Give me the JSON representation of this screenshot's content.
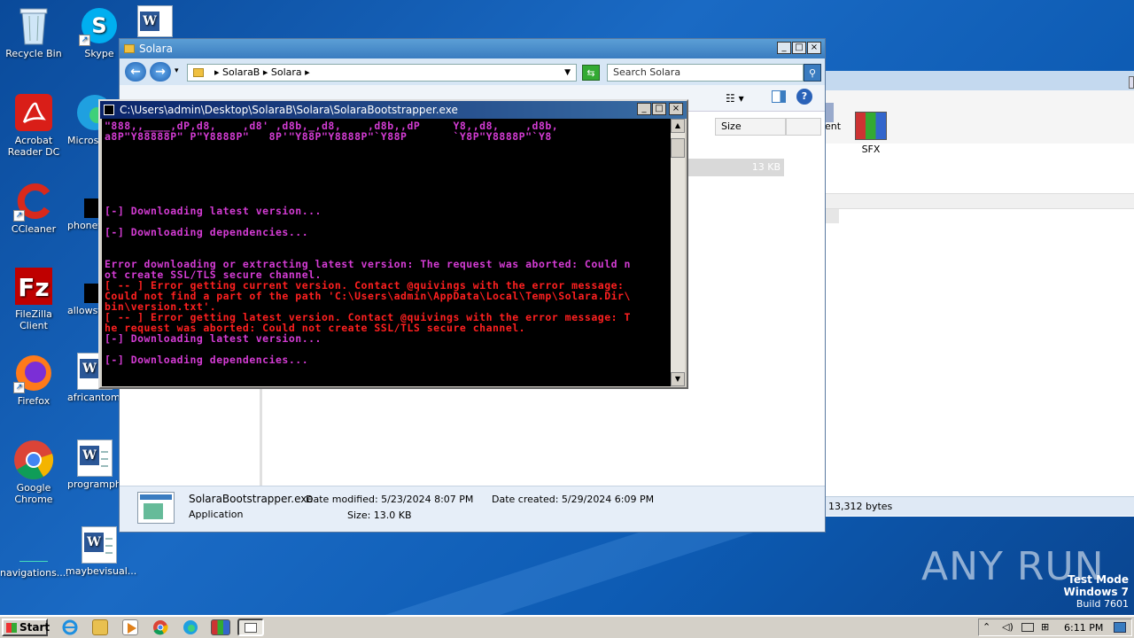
{
  "desktop_icons": [
    {
      "label": "Recycle Bin",
      "icon": "recycle-bin-icon"
    },
    {
      "label": "Skype",
      "icon": "skype-icon"
    },
    {
      "label": "Acrobat Reader DC",
      "icon": "acrobat-icon"
    },
    {
      "label": "Microso",
      "icon": "edge-icon"
    },
    {
      "label": "CCleaner",
      "icon": "ccleaner-icon"
    },
    {
      "label": "phonet",
      "icon": "file-icon"
    },
    {
      "label": "FileZilla Client",
      "icon": "filezilla-icon"
    },
    {
      "label": "allowsf",
      "icon": "file-icon"
    },
    {
      "label": "Firefox",
      "icon": "firefox-icon"
    },
    {
      "label": "africantom.",
      "icon": "word-doc-icon"
    },
    {
      "label": "Google Chrome",
      "icon": "chrome-icon"
    },
    {
      "label": "programph",
      "icon": "word-doc-icon"
    },
    {
      "label": "navigations....",
      "icon": "file-icon"
    },
    {
      "label": "maybevisual...",
      "icon": "word-doc-icon"
    }
  ],
  "explorer": {
    "title": "Solara",
    "breadcrumb": [
      "SolaraB",
      "Solara"
    ],
    "search_placeholder": "Search Solara",
    "column_size": "Size",
    "file_size_cell": "13 KB",
    "details": {
      "filename": "SolaraBootstrapper.exe",
      "type": "Application",
      "date_modified_label": "Date modified:",
      "date_modified": "5/23/2024 8:07 PM",
      "date_created_label": "Date created:",
      "date_created": "5/29/2024 6:09 PM",
      "size_label": "Size:",
      "size": "13.0 KB"
    }
  },
  "bg_window": {
    "item1": "ent",
    "item2": "SFX",
    "status": "13,312 bytes"
  },
  "console": {
    "title": "C:\\Users\\admin\\Desktop\\SolaraB\\Solara\\SolaraBootstrapper.exe",
    "lines": [
      {
        "text": "\"888,,____,dP,d8,    ,d8' ,d8b,_,d8,    ,d8b,,dP     Y8,,d8,    ,d8b,",
        "color": "mag"
      },
      {
        "text": "a8P\"Y88888P\" P\"Y8888P\"   8P'\"Y88P\"Y8888P\"`Y88P       `Y8P\"Y8888P\"`Y8",
        "color": "mag"
      },
      {
        "text": "[-] Downloading latest version...",
        "color": "mag"
      },
      {
        "text": "[-] Downloading dependencies...",
        "color": "mag"
      },
      {
        "text": "Error downloading or extracting latest version: The request was aborted: Could n",
        "color": "mag"
      },
      {
        "text": "ot create SSL/TLS secure channel.",
        "color": "mag"
      },
      {
        "text": "[ -- ] Error getting current version. Contact @quivings with the error message:",
        "color": "red"
      },
      {
        "text": "Could not find a part of the path 'C:\\Users\\admin\\AppData\\Local\\Temp\\Solara.Dir\\",
        "color": "red"
      },
      {
        "text": "bin\\version.txt'.",
        "color": "red"
      },
      {
        "text": "[ -- ] Error getting latest version. Contact @quivings with the error message: T",
        "color": "red"
      },
      {
        "text": "he request was aborted: Could not create SSL/TLS secure channel.",
        "color": "red"
      },
      {
        "text": "[-] Downloading latest version...",
        "color": "mag"
      },
      {
        "text": "[-] Downloading dependencies...",
        "color": "mag"
      }
    ]
  },
  "watermark": {
    "brand": "ANY RUN",
    "mode": "Test Mode",
    "os": "Windows 7",
    "build": "Build 7601"
  },
  "taskbar": {
    "start_label": "Start",
    "clock": "6:11 PM"
  }
}
